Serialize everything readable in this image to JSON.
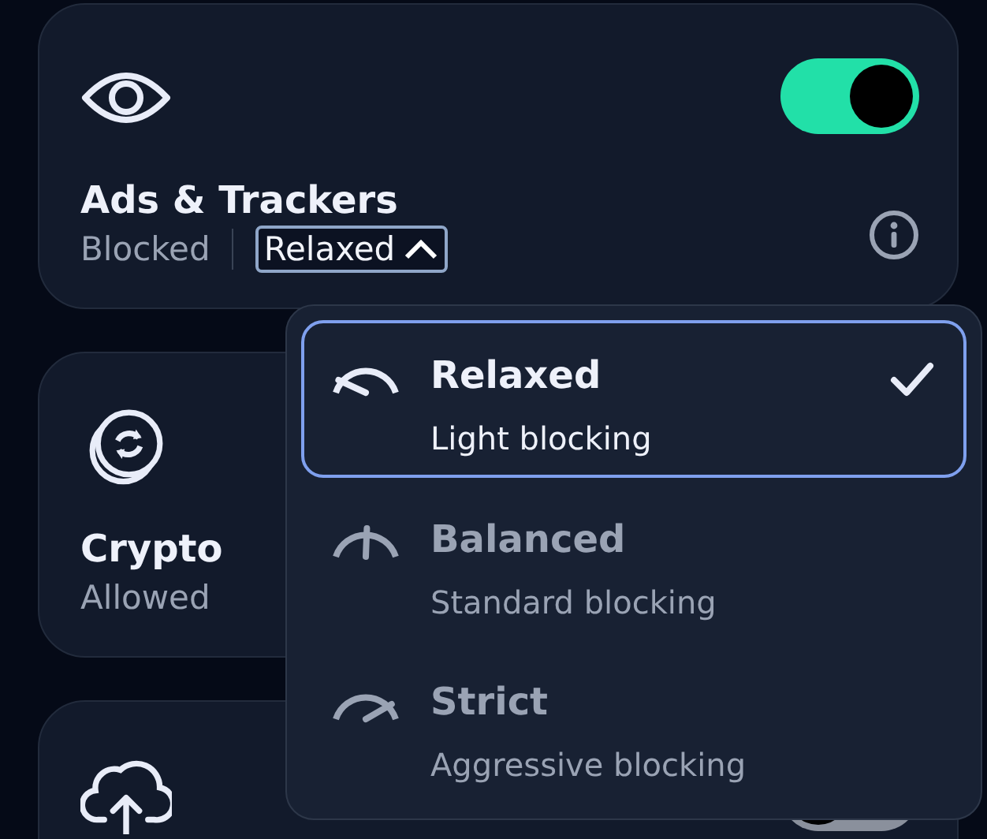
{
  "cards": [
    {
      "kind": "eye",
      "title": "Ads & Trackers",
      "status": "Blocked",
      "mode": {
        "label": "Relaxed",
        "expanded": true
      },
      "toggle": {
        "on": true
      },
      "info": true
    },
    {
      "kind": "coin",
      "title": "Crypto",
      "status": "Allowed"
    },
    {
      "kind": "cloud",
      "toggle": {
        "on": false
      }
    }
  ],
  "menu": {
    "options": [
      {
        "kind": "low",
        "title": "Relaxed",
        "subtitle": "Light blocking",
        "selected": true
      },
      {
        "kind": "medium",
        "title": "Balanced",
        "subtitle": "Standard blocking",
        "selected": false
      },
      {
        "kind": "high",
        "title": "Strict",
        "subtitle": "Aggressive blocking",
        "selected": false
      }
    ]
  }
}
